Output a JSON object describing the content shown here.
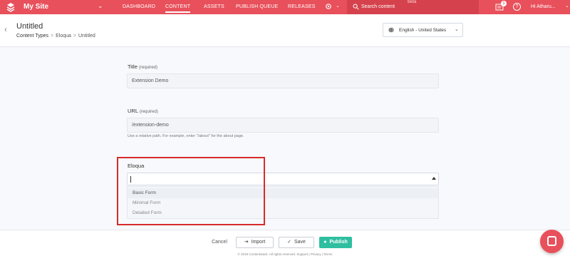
{
  "topbar": {
    "site_name": "My Site",
    "nav": [
      "DASHBOARD",
      "CONTENT",
      "ASSETS",
      "PUBLISH QUEUE",
      "RELEASES"
    ],
    "active_nav": "CONTENT",
    "search_placeholder": "Search content",
    "beta": "Beta",
    "notification_count": "1",
    "help": "?",
    "user_greeting": "Hi Atharu..."
  },
  "header": {
    "title": "Untitled",
    "breadcrumbs": [
      "Content Types",
      "Eloqua",
      "Untitled"
    ],
    "locale": "English - United States"
  },
  "form": {
    "title_label": "Title",
    "title_required": "(required)",
    "title_value": "Extension Demo",
    "url_label": "URL",
    "url_required": "(required)",
    "url_value": "/extension-demo",
    "url_hint": "Use a relative path. For example, enter \"/about\" for the about page.",
    "eloqua_label": "Eloqua",
    "eloqua_options": [
      "Basic Form",
      "Minimal Form",
      "Detailed Form"
    ]
  },
  "footer": {
    "cancel": "Cancel",
    "import": "Import",
    "save": "Save",
    "publish": "Publish",
    "copyright": "© 2019 Contentstack. All rights reserved. Support | Privacy | Terms"
  },
  "colors": {
    "brand": "#e8505b",
    "publish": "#2fbfa0",
    "highlight": "#d72b2b"
  }
}
